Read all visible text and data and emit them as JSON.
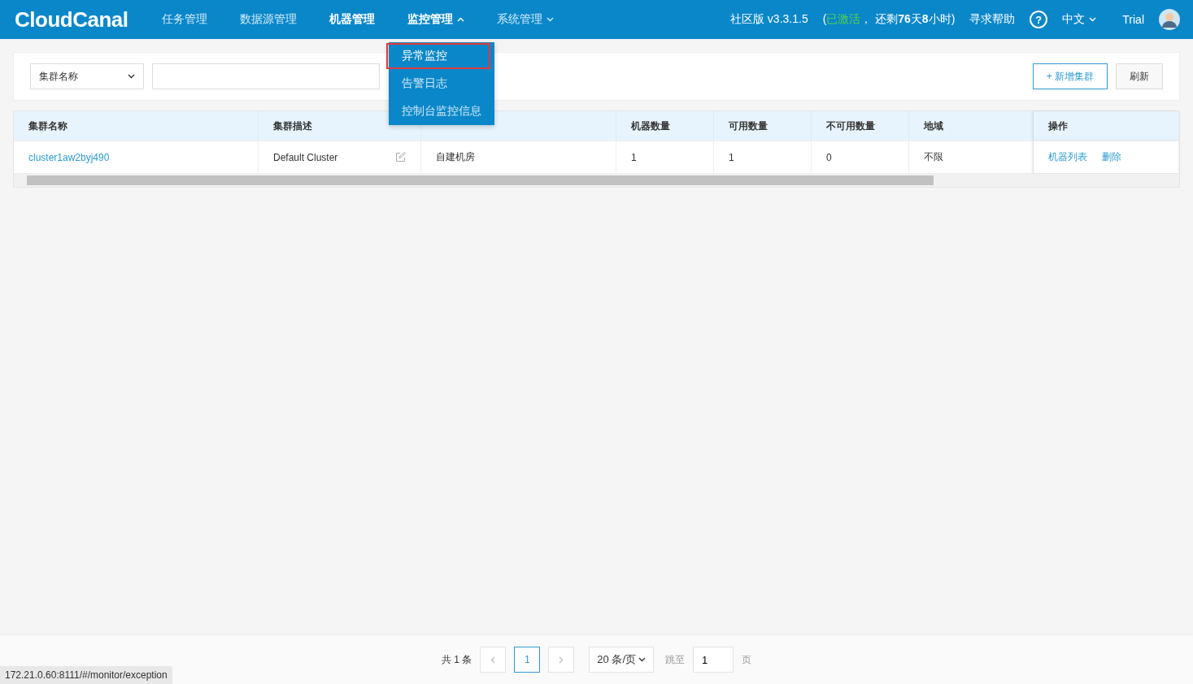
{
  "header": {
    "logo": "CloudCanal",
    "nav": [
      {
        "label": "任务管理",
        "selected": false
      },
      {
        "label": "数据源管理",
        "selected": false
      },
      {
        "label": "机器管理",
        "selected": true
      },
      {
        "label": "监控管理",
        "selected": true,
        "expanded": true
      },
      {
        "label": "系统管理",
        "selected": false,
        "expanded": false
      }
    ],
    "edition": "社区版 v3.3.1.5",
    "license_open": "(",
    "license_status": "已激活",
    "license_rest": "， 还剩**76**天**8**小时)",
    "help": "寻求帮助",
    "help_icon": "?",
    "language": "中文",
    "user": "Trial"
  },
  "dropdown": [
    {
      "label": "异常监控",
      "selected": true,
      "annotated": true
    },
    {
      "label": "告警日志",
      "selected": false,
      "annotated": false
    },
    {
      "label": "控制台监控信息",
      "selected": false,
      "annotated": false
    }
  ],
  "filter": {
    "field_select": "集群名称",
    "add_button": "+ 新增集群",
    "refresh_button": "刷新"
  },
  "table": {
    "columns": [
      "集群名称",
      "集群描述",
      null,
      "机器数量",
      "可用数量",
      "不可用数量",
      "地域",
      "操作"
    ],
    "rows": [
      {
        "name": "cluster1aw2byj490",
        "description": "Default Cluster",
        "type": "自建机房",
        "machines": "1",
        "available": "1",
        "unavailable": "0",
        "region": "不限",
        "actions": [
          "机器列表",
          "删除"
        ]
      }
    ]
  },
  "pagination": {
    "total": "共 1 条",
    "pages": [
      {
        "label": "1",
        "selected": true
      }
    ],
    "page_size": "20 条/页",
    "jump_label": "跳至",
    "jump_value": "1",
    "page_unit": "页"
  },
  "status_url": "172.21.0.60:8111/#/monitor/exception"
}
